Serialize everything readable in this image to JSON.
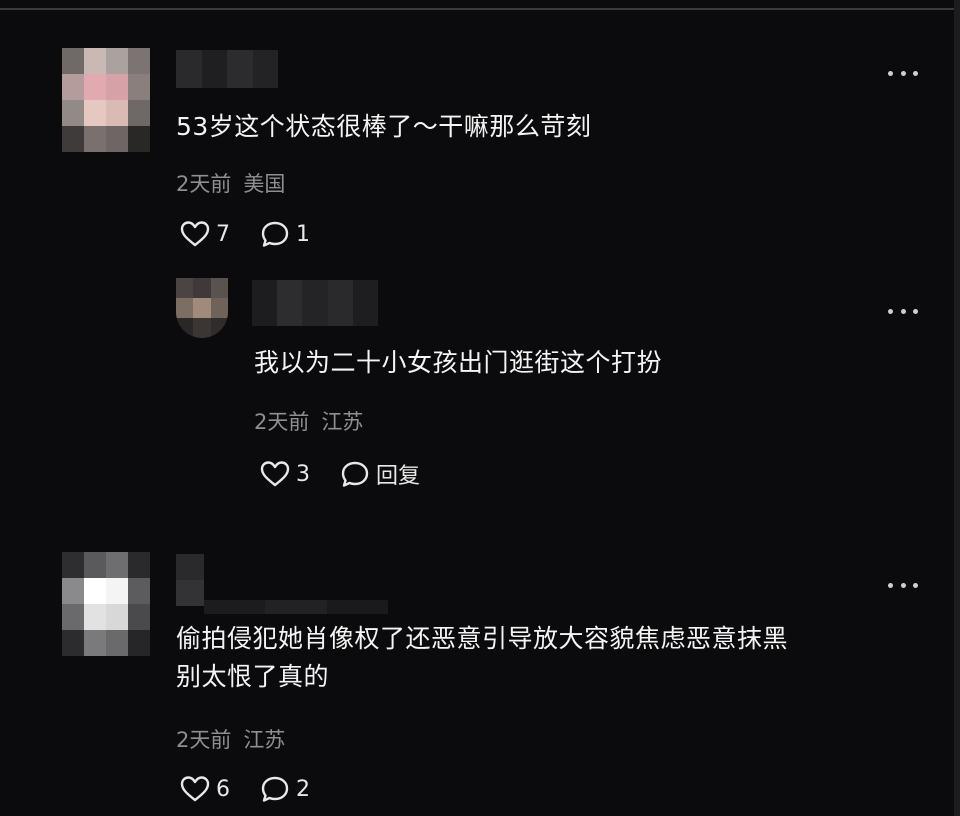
{
  "comments": [
    {
      "text": "53岁这个状态很棒了～干嘛那么苛刻",
      "time": "2天前",
      "location": "美国",
      "likes": "7",
      "replies": "1",
      "avatar_colors": [
        "#6f6a68",
        "#c9b8b3",
        "#a9a29f",
        "#7c7472",
        "#b59c9c",
        "#e3a9b0",
        "#d6a2a7",
        "#8a7f7c",
        "#928a87",
        "#e6c8c2",
        "#d9bab4",
        "#6e6866",
        "#3e3b3a",
        "#7a716e",
        "#6d6664",
        "#2a2827"
      ]
    },
    {
      "text": "我以为二十小女孩出门逛街这个打扮",
      "time": "2天前",
      "location": "江苏",
      "likes": "3",
      "reply_label": "回复",
      "avatar_colors": [
        "#4a4442",
        "#3f3a39",
        "#5a524f",
        "#7d6e64",
        "#a08a7b",
        "#6f625a",
        "#2a2727",
        "#3b3634",
        "#2f2c2b"
      ]
    },
    {
      "text": "偷拍侵犯她肖像权了还恶意引导放大容貌焦虑恶意抹黑\n别太恨了真的",
      "time": "2天前",
      "location": "江苏",
      "likes": "6",
      "replies": "2",
      "avatar_colors": [
        "#2e2e30",
        "#5a5a5c",
        "#6e6e70",
        "#2a2a2c",
        "#8a8a8c",
        "#ffffff",
        "#f4f4f4",
        "#5c5c5e",
        "#6a6a6c",
        "#e2e2e2",
        "#d8d8d8",
        "#4a4a4c",
        "#2c2c2e",
        "#7a7a7c",
        "#6a6a6c",
        "#262628"
      ]
    }
  ]
}
